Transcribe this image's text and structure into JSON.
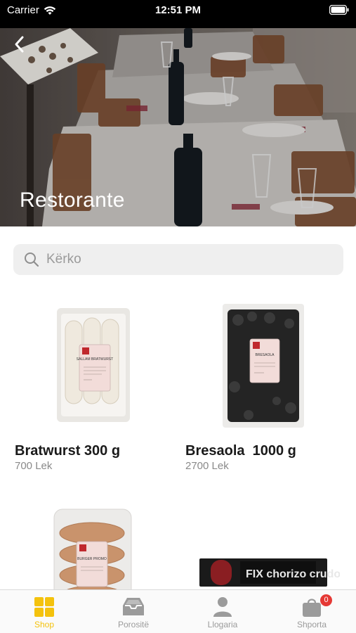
{
  "status_bar": {
    "carrier": "Carrier",
    "time": "12:51 PM"
  },
  "header": {
    "title": "Restorante",
    "back_icon": "chevron-left-icon"
  },
  "search": {
    "placeholder": "Kërko",
    "value": ""
  },
  "products": [
    {
      "name": "Bratwurst 300 g",
      "price": "700 Lek",
      "package_text": "SALLAM BRATWURST"
    },
    {
      "name": "Bresaola  1000 g",
      "price": "2700 Lek",
      "package_text": "BRESAOLA"
    },
    {
      "name": "",
      "price": "",
      "package_text": "BURGER PROMO"
    },
    {
      "name": "",
      "price": "",
      "package_text": "FIX chorizo crudo"
    }
  ],
  "tabbar": {
    "tabs": [
      {
        "label": "Shop",
        "icon": "grid-icon",
        "active": true
      },
      {
        "label": "Porositë",
        "icon": "tray-icon",
        "active": false
      },
      {
        "label": "Llogaria",
        "icon": "person-icon",
        "active": false
      },
      {
        "label": "Shporta",
        "icon": "bag-icon",
        "active": false,
        "badge": "0"
      }
    ]
  },
  "colors": {
    "accent": "#f4c20d",
    "badge": "#e53935",
    "search_bg": "#efefef"
  }
}
